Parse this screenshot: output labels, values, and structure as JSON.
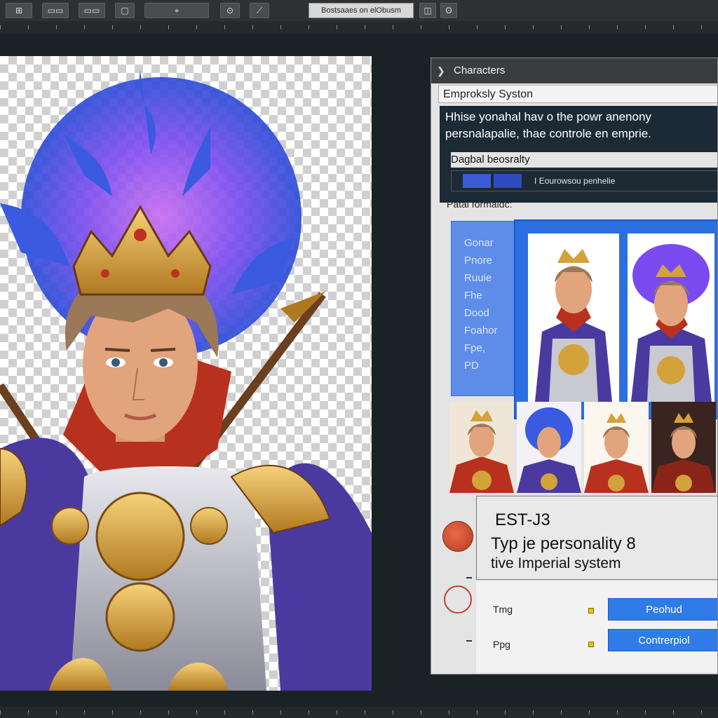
{
  "toolbar": {
    "title": "Bostsaaes on elObusm",
    "buttons": [
      "⊞",
      "▭▭",
      "▭▭",
      "▢",
      "⌖",
      "⊙",
      "⟋",
      "◫",
      "ʘ"
    ]
  },
  "panel": {
    "header": "Characters",
    "header_icon": "chevron-icon",
    "system_title": "Emproksly Syston",
    "description": [
      "Hhise yonahal hav o the powr anenony",
      "persnalapalie, thae controle en emprie."
    ],
    "digital_label": "Dagbal beosralty",
    "digital_value": "I Eourowsou penhelie",
    "portrait_label": "Patal formaldc:",
    "attributes": [
      "Gonar",
      "Pnore",
      "Ruuie",
      "Fhe",
      "Dood",
      "Foahor",
      "Fpe,",
      "PD"
    ],
    "info": {
      "code": "EST-J3",
      "line2": "Typ je personality 8",
      "line3": "tive Imperial system"
    },
    "controls": [
      {
        "label": "Tmg",
        "button": "Peohud"
      },
      {
        "label": "Ppg",
        "button": "Contrerpiol"
      }
    ]
  },
  "colors": {
    "accent_blue": "#2f7be8",
    "panel_dark": "#1c2a36",
    "gold": "#d4a23a",
    "cape_purple": "#4a3aa0"
  }
}
